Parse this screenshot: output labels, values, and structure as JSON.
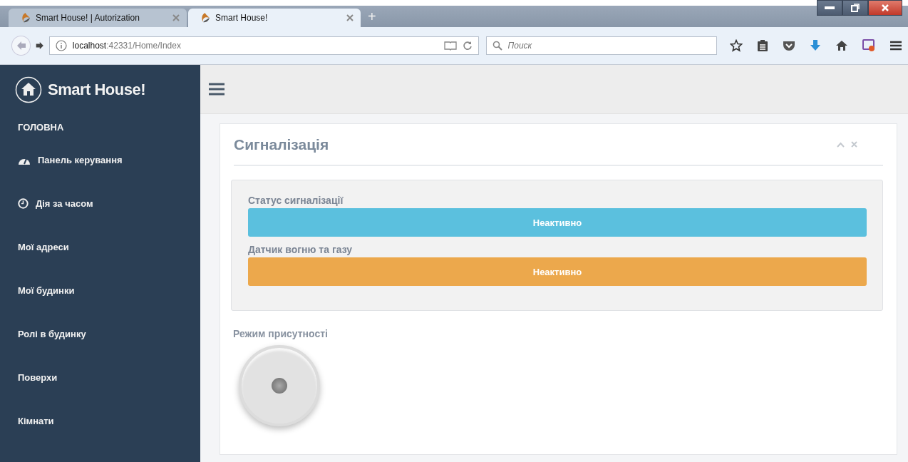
{
  "browser": {
    "tabs": [
      {
        "title": "Smart House! | Autorization",
        "selected": false
      },
      {
        "title": "Smart House!",
        "selected": true
      }
    ],
    "new_tab": "+",
    "address": {
      "host": "localhost",
      "path": ":42331/Home/Index"
    },
    "search": {
      "placeholder": "Поиск"
    }
  },
  "sidebar": {
    "brand": "Smart House!",
    "section": "ГОЛОВНА",
    "items": [
      {
        "label": "Панель керування",
        "kind": "dashboard"
      },
      {
        "label": "Дія за часом",
        "kind": "timer"
      },
      {
        "label": "Мої адреси",
        "kind": "plain"
      },
      {
        "label": "Мої будинки",
        "kind": "plain"
      },
      {
        "label": "Ролі в будинку",
        "kind": "plain"
      },
      {
        "label": "Поверхи",
        "kind": "plain"
      },
      {
        "label": "Кімнати",
        "kind": "plain"
      }
    ]
  },
  "panel": {
    "title": "Сигналізація",
    "statuses": [
      {
        "label": "Статус сигналізації",
        "value": "Неактивно",
        "color": "#5bc0de"
      },
      {
        "label": "Датчик вогню та газу",
        "value": "Неактивно",
        "color": "#eca84c"
      }
    ],
    "presence": {
      "label": "Режим присутності",
      "on": false
    }
  }
}
